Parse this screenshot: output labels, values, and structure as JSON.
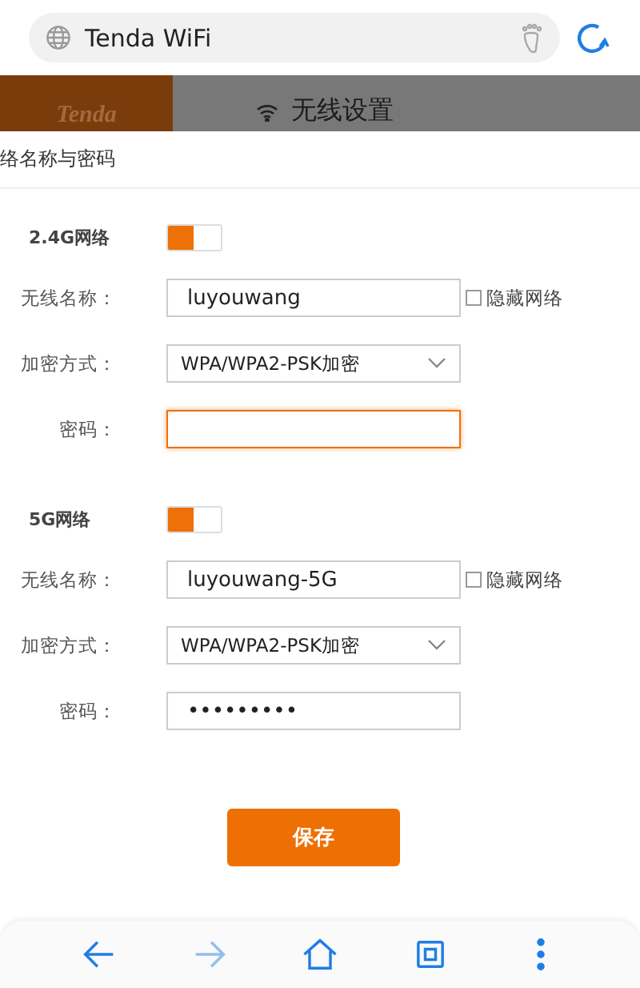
{
  "browser": {
    "address": "Tenda WiFi"
  },
  "page_header": {
    "logo": "Tenda",
    "title": "无线设置"
  },
  "dialog": {
    "title": "络名称与密码",
    "sections": [
      {
        "label": "2.4G网络",
        "enabled": true,
        "fields": [
          {
            "kind": "text",
            "label": "无线名称：",
            "value": "luyouwang",
            "focused": false,
            "checkbox": {
              "label": "隐藏网络",
              "checked": false
            }
          },
          {
            "kind": "select",
            "label": "加密方式：",
            "value": "WPA/WPA2-PSK加密",
            "focused": false
          },
          {
            "kind": "text",
            "label": "密码：",
            "focused": true
          }
        ]
      },
      {
        "label": "5G网络",
        "enabled": true,
        "fields": [
          {
            "kind": "text",
            "label": "无线名称：",
            "value": "luyouwang-5G",
            "focused": false,
            "checkbox": {
              "label": "隐藏网络",
              "checked": false
            }
          },
          {
            "kind": "select",
            "label": "加密方式：",
            "value": "WPA/WPA2-PSK加密",
            "focused": false
          },
          {
            "kind": "text",
            "label": "密码：",
            "value": "•••••••••",
            "focused": false
          }
        ]
      }
    ],
    "save_button": "保存"
  },
  "toolbar": [
    {
      "kind": "back",
      "disabled": false
    },
    {
      "kind": "forward",
      "disabled": true
    },
    {
      "kind": "home",
      "disabled": false
    },
    {
      "kind": "tabs",
      "disabled": false
    },
    {
      "kind": "menu",
      "disabled": false
    }
  ]
}
